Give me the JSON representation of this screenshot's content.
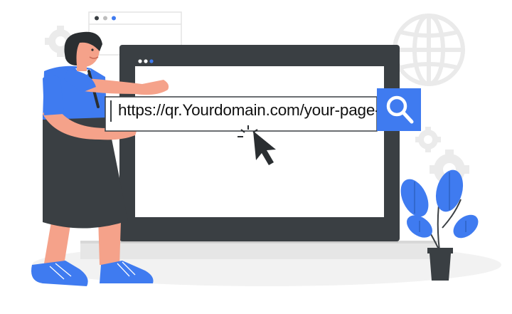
{
  "address_bar": {
    "url": "https://qr.Yourdomain.com/your-page-id"
  },
  "icons": {
    "search": "search-icon",
    "cursor": "cursor-arrow-icon",
    "globe": "globe-icon",
    "gear": "gear-icon",
    "plant": "potted-plant-icon"
  },
  "colors": {
    "accent_blue": "#3F7BF0",
    "dark_gray": "#3A3F43",
    "skin": "#F5A28A",
    "light_gray": "#EDEDED"
  }
}
